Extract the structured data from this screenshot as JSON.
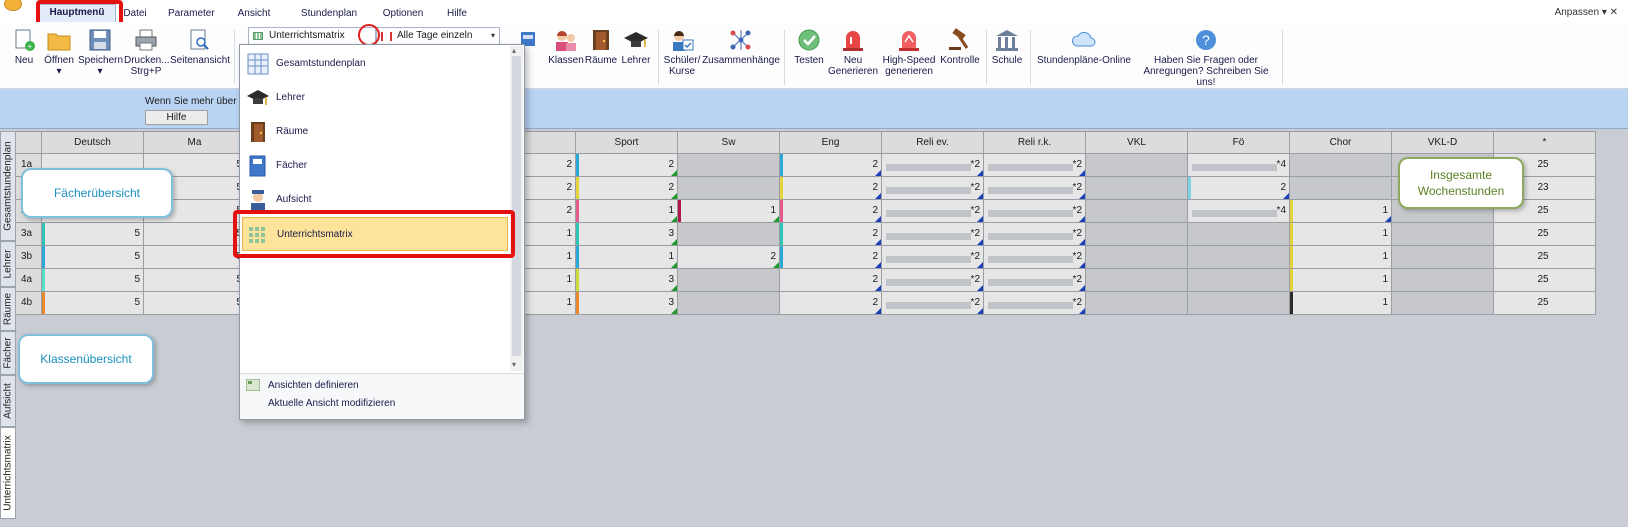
{
  "menu": {
    "items": [
      "Hauptmenü",
      "Datei",
      "Parameter",
      "Ansicht",
      "Stundenplan",
      "Optionen",
      "Hilfe"
    ],
    "active_index": 0,
    "customize": "Anpassen ▾ ✕"
  },
  "ribbon": {
    "neu": "Neu",
    "oeffnen": "Öffnen",
    "speichern": "Speichern",
    "drucken": "Drucken...",
    "drucken_shortcut": "Strg+P",
    "seitenansicht": "Seitenansicht",
    "view_combo": "Unterrichtsmatrix",
    "day_combo": "Alle Tage einzeln",
    "klassen": "Klassen",
    "raeume": "Räume",
    "lehrer": "Lehrer",
    "schueler": "Schüler/",
    "kurse": "Kurse",
    "zusammenhaenge": "Zusammenhänge",
    "testen": "Testen",
    "neu_gen_1": "Neu",
    "neu_gen_2": "Generieren",
    "high_1": "High-Speed",
    "high_2": "generieren",
    "kontrolle": "Kontrolle",
    "schule": "Schule",
    "online": "Stundenpläne-Online",
    "feedback_1": "Haben Sie Fragen oder",
    "feedback_2": "Anregungen? Schreiben Sie uns!"
  },
  "info": {
    "text": "Wenn Sie mehr über dies",
    "help": "Hilfe"
  },
  "vtabs": [
    "Gesamtstundenplan",
    "Lehrer",
    "Räume",
    "Fächer",
    "Aufsicht",
    "Unterrichtsmatrix"
  ],
  "popup": {
    "items": [
      "Gesamtstundenplan",
      "Lehrer",
      "Räume",
      "Fächer",
      "Aufsicht",
      "Unterrichtsmatrix"
    ],
    "footer_1": "Ansichten definieren",
    "footer_2": "Aktuelle Ansicht modifizieren"
  },
  "grid": {
    "columns": [
      "Deutsch",
      "Ma",
      "Sport",
      "Sw",
      "Eng",
      "Reli ev.",
      "Reli r.k.",
      "VKL",
      "Fö",
      "Chor",
      "VKL-D",
      "*"
    ],
    "rows": [
      {
        "cls": "1a",
        "deutsch": "",
        "ma": "5",
        "hidden": "2",
        "sport": "2",
        "sw": "",
        "eng": "2",
        "reliev": "*2",
        "relirk": "*2",
        "vkl": "",
        "foe": "*4",
        "chor": "",
        "vkld": "",
        "total": "25"
      },
      {
        "cls": "1b",
        "deutsch": "",
        "ma": "5",
        "hidden": "2",
        "sport": "2",
        "sw": "",
        "eng": "2",
        "reliev": "*2",
        "relirk": "*2",
        "vkl": "",
        "foe": "2",
        "chor": "",
        "vkld": "",
        "total": "23"
      },
      {
        "cls": "2",
        "deutsch": "",
        "ma": "5",
        "hidden": "2",
        "sport": "1",
        "sw": "1",
        "eng": "2",
        "reliev": "*2",
        "relirk": "*2",
        "vkl": "",
        "foe": "*4",
        "chor": "1",
        "vkld": "",
        "total": "25"
      },
      {
        "cls": "3a",
        "deutsch": "5",
        "ma": "5",
        "hidden": "1",
        "sport": "3",
        "sw": "",
        "eng": "2",
        "reliev": "*2",
        "relirk": "*2",
        "vkl": "",
        "foe": "",
        "chor": "1",
        "vkld": "",
        "total": "25"
      },
      {
        "cls": "3b",
        "deutsch": "5",
        "ma": "5",
        "hidden": "1",
        "sport": "1",
        "sw": "2",
        "eng": "2",
        "reliev": "*2",
        "relirk": "*2",
        "vkl": "",
        "foe": "",
        "chor": "1",
        "vkld": "",
        "total": "25"
      },
      {
        "cls": "4a",
        "deutsch": "5",
        "ma": "5",
        "hidden": "1",
        "sport": "3",
        "sw": "",
        "eng": "2",
        "reliev": "*2",
        "relirk": "*2",
        "vkl": "",
        "foe": "",
        "chor": "1",
        "vkld": "",
        "total": "25"
      },
      {
        "cls": "4b",
        "deutsch": "5",
        "ma": "5",
        "hidden": "1",
        "sport": "3",
        "sw": "",
        "eng": "2",
        "reliev": "*2",
        "relirk": "*2",
        "vkl": "",
        "foe": "",
        "chor": "1",
        "vkld": "",
        "total": "25"
      }
    ]
  },
  "callouts": {
    "faecher": "Fächerübersicht",
    "klassen": "Klassenübersicht",
    "wochen_1": "Insgesamte",
    "wochen_2": "Wochenstunden"
  },
  "colors": {
    "highlight_red": "#e51010",
    "selected_item_bg": "#fde49a",
    "info_bar": "#b9d3f2",
    "accent_blue": "#1b3fb8"
  }
}
